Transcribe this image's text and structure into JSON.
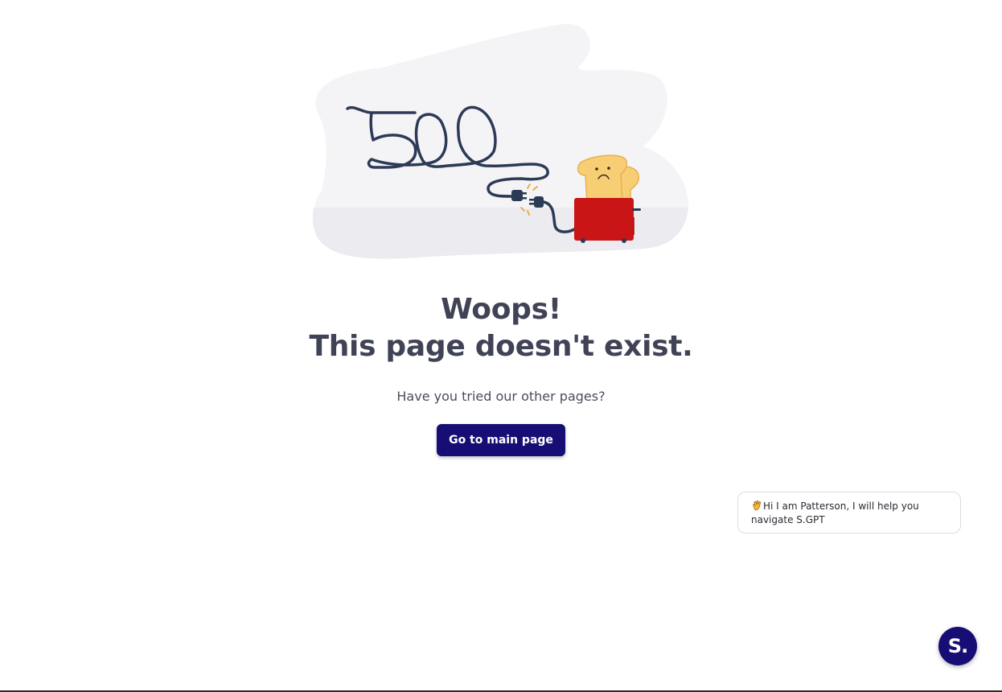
{
  "illustration": {
    "error_code": "500",
    "toaster_color": "#c91515",
    "toast_color": "#f7ce73",
    "cord_color": "#2d3a56",
    "blob_color": "#f4f4f6"
  },
  "headline": {
    "line1": "Woops!",
    "line2": "This page doesn't exist."
  },
  "subtext": "Have you tried our other pages?",
  "main_button": {
    "label": "Go to main page",
    "color": "#160e74"
  },
  "chat": {
    "greeting_icon": "waving-hand-icon",
    "message": "Hi I am Patterson, I will help you navigate S.GPT",
    "launcher_label": "S.",
    "launcher_icon": "chat-logo-icon"
  }
}
